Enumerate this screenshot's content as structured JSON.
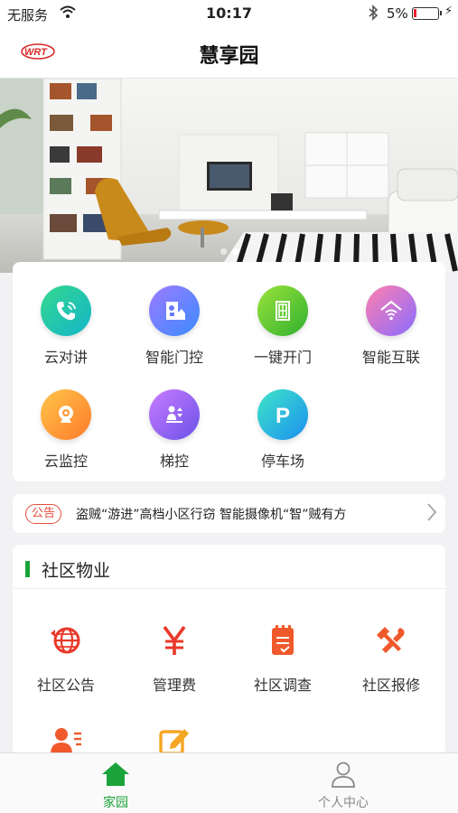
{
  "status": {
    "carrier": "无服务",
    "time": "10:17",
    "battery": "5%"
  },
  "navbar": {
    "title": "慧享园",
    "logo_text": "WRT"
  },
  "quick": [
    {
      "label": "云对讲",
      "icon": "phone-icon",
      "gradient": [
        "#36d98e",
        "#12b5c9"
      ]
    },
    {
      "label": "智能门控",
      "icon": "door-control-icon",
      "gradient": [
        "#9b7bff",
        "#3c8bff"
      ]
    },
    {
      "label": "一键开门",
      "icon": "door-open-icon",
      "gradient": [
        "#9be33a",
        "#2fb02f"
      ]
    },
    {
      "label": "智能互联",
      "icon": "smart-home-icon",
      "gradient": [
        "#ff7fae",
        "#8a6cff"
      ]
    },
    {
      "label": "云监控",
      "icon": "camera-icon",
      "gradient": [
        "#ffc64a",
        "#ff7a2a"
      ]
    },
    {
      "label": "梯控",
      "icon": "elevator-icon",
      "gradient": [
        "#c97bff",
        "#6a52e8"
      ]
    },
    {
      "label": "停车场",
      "icon": "parking-icon",
      "gradient": [
        "#3ee6c8",
        "#1c8ff0"
      ]
    }
  ],
  "notice": {
    "tag": "公告",
    "text": "盗贼“游进”高档小区行窃 智能摄像机“智”贼有方"
  },
  "community": {
    "title": "社区物业",
    "items": [
      {
        "label": "社区公告",
        "icon": "globe-icon"
      },
      {
        "label": "管理费",
        "icon": "yen-icon"
      },
      {
        "label": "社区调查",
        "icon": "survey-icon"
      },
      {
        "label": "社区报修",
        "icon": "repair-icon"
      },
      {
        "label": "",
        "icon": "contact-icon"
      },
      {
        "label": "",
        "icon": "edit-icon"
      }
    ]
  },
  "tabs": [
    {
      "label": "家园",
      "icon": "home-icon",
      "active": true
    },
    {
      "label": "个人中心",
      "icon": "person-icon",
      "active": false
    }
  ],
  "colors": {
    "accent": "#1aa33a",
    "notice": "#e74c3c",
    "orange": "#f0592b"
  }
}
